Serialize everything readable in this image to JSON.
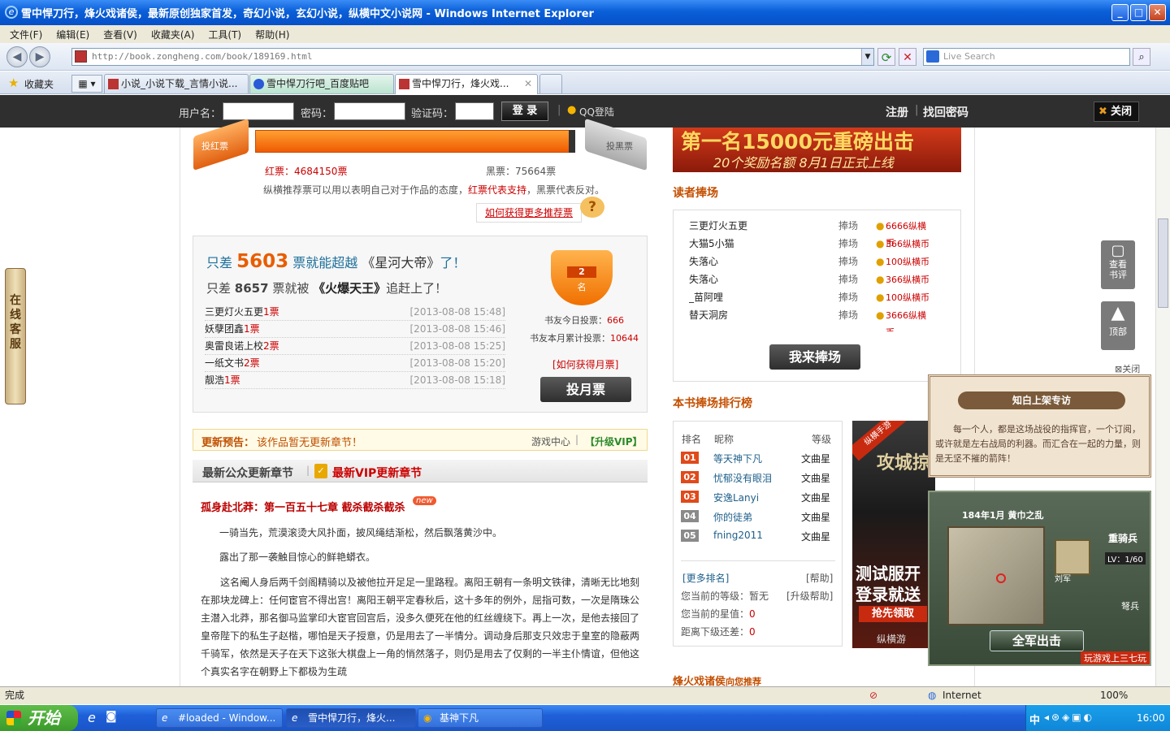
{
  "window": {
    "title": "雪中悍刀行，烽火戏诸侯，最新原创独家首发，奇幻小说，玄幻小说，纵横中文小说网 - Windows Internet Explorer"
  },
  "menu": [
    "文件(F)",
    "编辑(E)",
    "查看(V)",
    "收藏夹(A)",
    "工具(T)",
    "帮助(H)"
  ],
  "address": {
    "url": "http://book.zongheng.com/book/189169.html",
    "search_placeholder": "Live Search"
  },
  "favorites_label": "收藏夹",
  "tabs": [
    {
      "label": "小说_小说下载_言情小说..."
    },
    {
      "label": "雪中悍刀行吧_百度贴吧"
    },
    {
      "label": "雪中悍刀行，烽火戏..."
    }
  ],
  "login": {
    "user_label": "用户名：",
    "pass_label": "密码：",
    "captcha_label": "验证码：",
    "login_btn": "登 录",
    "qq": "QQ登陆",
    "register": "注册",
    "find_pass": "找回密码",
    "close": "关闭"
  },
  "vote": {
    "red_label": "投红票",
    "black_label": "投黑票",
    "red_count": "红票：4684150票",
    "black_count": "黑票：75664票",
    "desc_pre": "纵横推荐票可以用以表明自己对于作品的态度，",
    "desc_red": "红票代表支持",
    "desc_post": "，黑票代表反对。",
    "more_link": "如何获得更多推荐票"
  },
  "monthly": {
    "line1_pre": "只差",
    "line1_num": "5603",
    "line1_mid": "票就能超越",
    "line1_book": "《星河大帝》",
    "line1_post": "了！",
    "line2_pre": "只差",
    "line2_num": "8657",
    "line2_mid": "票就被",
    "line2_book": "《火爆天王》",
    "line2_post": "追赶上了！",
    "rank_num": "2",
    "rank_suffix": "名",
    "today_label": "书友今日投票：",
    "today_val": "666",
    "month_label": "书友本月累计投票：",
    "month_val": "10644",
    "how_link": "[如何获得月票]",
    "vote_btn": "投月票",
    "records": [
      {
        "user": "三更灯火五更",
        "votes": "1票",
        "time": "[2013-08-08 15:48]"
      },
      {
        "user": "妖孽团鑫",
        "votes": "1票",
        "time": "[2013-08-08 15:46]"
      },
      {
        "user": "奥雷良诺上校",
        "votes": "2票",
        "time": "[2013-08-08 15:25]"
      },
      {
        "user": "一纸文书",
        "votes": "2票",
        "time": "[2013-08-08 15:20]"
      },
      {
        "user": "靓浩",
        "votes": "1票",
        "time": "[2013-08-08 15:18]"
      }
    ]
  },
  "update": {
    "label": "更新预告：",
    "text": "该作品暂无更新章节！",
    "game": "游戏中心",
    "vip": "【升级VIP】"
  },
  "chapters": {
    "tab_public": "最新公众更新章节",
    "tab_vip": "最新VIP更新章节",
    "title": "孤身赴北莽：第一百五十七章 截杀截杀截杀",
    "new_badge": "new",
    "p1": "一骑当先，荒漠滚烫大风扑面，披风绳结渐松，然后飘落黄沙中。",
    "p2": "露出了那一袭触目惊心的鲜艳蟒衣。",
    "p3": "这名阉人身后两千剑阁精骑以及被他拉开足足一里路程。离阳王朝有一条明文铁律，清晰无比地刻在那块龙碑上：任何宦官不得出宫！离阳王朝平定春秋后，这十多年的例外，屈指可数，一次是隋珠公主潜入北莽，那名御马监掌印大宦官回宫后，没多久便死在他的红丝缠绕下。再上一次，是他去接回了皇帝陛下的私生子赵楷，哪怕是天子授意，仍是用去了一半情分。调动身后那支只效忠于皇室的隐蔽两千骑军，依然是天子在天下这张大棋盘上一角的悄然落子，则仍是用去了仅剩的一半主仆情谊，但他这个真实名字在朝野上下都极为生疏"
  },
  "right": {
    "banner_line1": "第一名15000元重磅出击",
    "banner_line2": "20个奖励名额 8月1日正式上线",
    "fans_title": "读者捧场",
    "fans": [
      {
        "name": "三更灯火五更",
        "act": "捧场",
        "amount": "6666纵横币"
      },
      {
        "name": "大猫5小猫",
        "act": "捧场",
        "amount": "366纵横币"
      },
      {
        "name": "失落心",
        "act": "捧场",
        "amount": "100纵横币"
      },
      {
        "name": "失落心",
        "act": "捧场",
        "amount": "366纵横币"
      },
      {
        "name": "_苗阿哩",
        "act": "捧场",
        "amount": "100纵横币"
      },
      {
        "name": "替天洞房",
        "act": "捧场",
        "amount": "3666纵横币"
      }
    ],
    "fans_btn": "我来捧场",
    "rank_title": "本书捧场排行榜",
    "rank_head": {
      "rank": "排名",
      "nick": "昵称",
      "level": "等级"
    },
    "ranks": [
      {
        "no": "01",
        "nick": "等天神下凡",
        "level": "文曲星"
      },
      {
        "no": "02",
        "nick": "忧郁没有眼泪",
        "level": "文曲星"
      },
      {
        "no": "03",
        "nick": "安逸Lanyi",
        "level": "文曲星"
      },
      {
        "no": "04",
        "nick": "你的徒弟",
        "level": "文曲星"
      },
      {
        "no": "05",
        "nick": "fning2011",
        "level": "文曲星"
      }
    ],
    "more_rank": "[更多排名]",
    "help": "[帮助]",
    "cur_level_label": "您当前的等级：",
    "cur_level": "暂无",
    "upgrade_help": "[升级帮助]",
    "stars_label": "您当前的星值：",
    "stars": "0",
    "gap_label": "距离下级还差：",
    "gap": "0",
    "bottom_title": "烽火戏诸侯",
    "bottom_sub": "向您推荐",
    "ad_text1": "攻城掠",
    "ad_text2": "测试服开",
    "ad_text3": "登录就送",
    "ad_btn": "抢先领取",
    "ad_tag": "纵横游",
    "ad_corner": "纵横手游"
  },
  "side": {
    "online": "在线客服",
    "review": "查看书评",
    "top": "顶部",
    "close": "关闭"
  },
  "popup": {
    "title": "知白上架专访",
    "text": "每一个人，都是这场战役的指挥官，一个订阅，或许就是左右战局的利器。而汇合在一起的力量，则是无坚不摧的箭阵！",
    "game_date": "184年1月 黄巾之乱",
    "hero": "刘军",
    "unit": "重骑兵",
    "lv": "LV：1/60",
    "unit2": "弩兵",
    "attack_btn": "全军出击",
    "footer": "玩游戏上三七玩"
  },
  "statusbar": {
    "text": "完成",
    "zone": "Internet",
    "zoom": "100%"
  },
  "taskbar": {
    "start": "开始",
    "tasks": [
      "#loaded - Window...",
      "雪中悍刀行，烽火...",
      "基神下凡"
    ],
    "ime": "中",
    "time": "16:00"
  }
}
